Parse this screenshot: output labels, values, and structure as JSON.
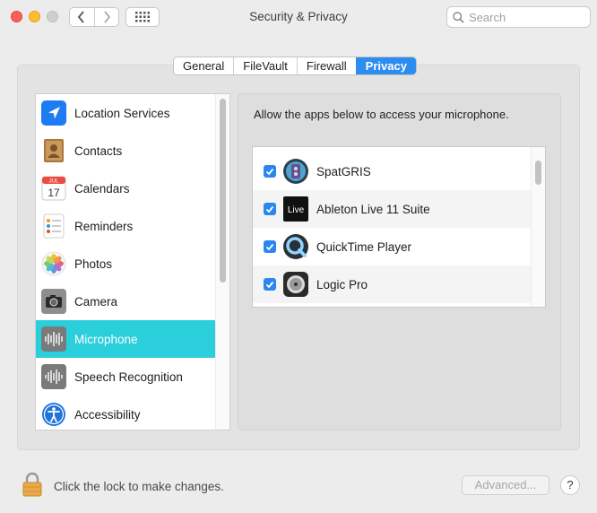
{
  "window": {
    "title": "Security & Privacy",
    "search_placeholder": "Search"
  },
  "tabs": [
    {
      "label": "General",
      "active": false
    },
    {
      "label": "FileVault",
      "active": false
    },
    {
      "label": "Firewall",
      "active": false
    },
    {
      "label": "Privacy",
      "active": true
    }
  ],
  "sidebar": {
    "items": [
      {
        "label": "Location Services",
        "icon": "location-arrow-icon"
      },
      {
        "label": "Contacts",
        "icon": "contacts-book-icon"
      },
      {
        "label": "Calendars",
        "icon": "calendar-icon",
        "icon_text": "17",
        "icon_month": "JUL"
      },
      {
        "label": "Reminders",
        "icon": "reminders-list-icon"
      },
      {
        "label": "Photos",
        "icon": "photos-flower-icon"
      },
      {
        "label": "Camera",
        "icon": "camera-icon"
      },
      {
        "label": "Microphone",
        "icon": "microphone-waveform-icon",
        "selected": true
      },
      {
        "label": "Speech Recognition",
        "icon": "speech-waveform-icon"
      },
      {
        "label": "Accessibility",
        "icon": "accessibility-person-icon"
      }
    ]
  },
  "panel": {
    "description": "Allow the apps below to access your microphone.",
    "apps": [
      {
        "name": "SpatGRIS",
        "checked": true,
        "icon": "spatgris-icon"
      },
      {
        "name": "Ableton Live 11 Suite",
        "checked": true,
        "icon": "ableton-live-icon",
        "icon_text": "Live"
      },
      {
        "name": "QuickTime Player",
        "checked": true,
        "icon": "quicktime-icon"
      },
      {
        "name": "Logic Pro",
        "checked": true,
        "icon": "logic-pro-icon"
      }
    ]
  },
  "footer": {
    "lock_text": "Click the lock to make changes.",
    "advanced_label": "Advanced...",
    "help_label": "?"
  },
  "colors": {
    "selection": "#2bcfdc",
    "accent": "#2d8cf0",
    "checkbox": "#2b86f0"
  }
}
